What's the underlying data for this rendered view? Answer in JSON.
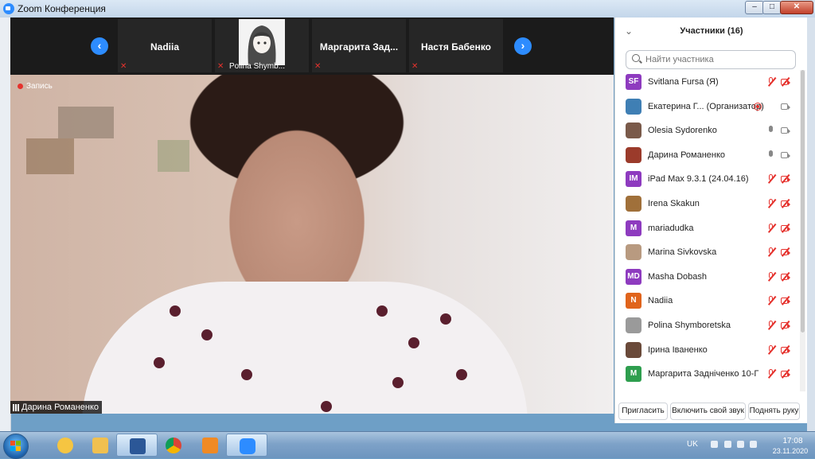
{
  "window": {
    "title": "Zoom Конференция",
    "btn_min": "–",
    "btn_max": "□",
    "btn_close": "✕"
  },
  "gallery": {
    "prev": "‹",
    "next": "›",
    "thumbs": [
      {
        "name": "Nadiia",
        "caption": ""
      },
      {
        "name": "",
        "caption": "Polina Shymb..."
      },
      {
        "name": "Маргарита  Зад...",
        "caption": ""
      },
      {
        "name": "Настя Бабенко",
        "caption": ""
      }
    ]
  },
  "video": {
    "recording": "Запись",
    "speaker": "Дарина Романенко"
  },
  "participants": {
    "title": "Участники (16)",
    "search_placeholder": "Найти участника",
    "list": [
      {
        "initials": "SF",
        "color": "#8e3bbf",
        "name": "Svitlana Fursa (Я)",
        "mic": "off",
        "cam": "off",
        "rec": false
      },
      {
        "initials": "",
        "color": "#3f7fb4",
        "name": "Екатерина Г... (Организатор)",
        "mic": "rec",
        "cam": "on",
        "rec": true
      },
      {
        "initials": "",
        "color": "#7a5a4a",
        "name": "Olesia Sydorenko",
        "mic": "on",
        "cam": "on",
        "rec": false
      },
      {
        "initials": "",
        "color": "#9b3b2b",
        "name": "Дарина Романенко",
        "mic": "on",
        "cam": "on",
        "rec": false
      },
      {
        "initials": "IM",
        "color": "#8e3bbf",
        "name": "iPad Max 9.3.1 (24.04.16)",
        "mic": "off",
        "cam": "off",
        "rec": false
      },
      {
        "initials": "",
        "color": "#a0703a",
        "name": "Irena Skakun",
        "mic": "off",
        "cam": "off",
        "rec": false
      },
      {
        "initials": "M",
        "color": "#8e3bbf",
        "name": "mariadudka",
        "mic": "off",
        "cam": "off",
        "rec": false
      },
      {
        "initials": "",
        "color": "#b89a80",
        "name": "Marina Sivkovska",
        "mic": "off",
        "cam": "off",
        "rec": false
      },
      {
        "initials": "MD",
        "color": "#8e3bbf",
        "name": "Masha Dobash",
        "mic": "off",
        "cam": "off",
        "rec": false
      },
      {
        "initials": "N",
        "color": "#e0641c",
        "name": "Nadiia",
        "mic": "off",
        "cam": "off",
        "rec": false
      },
      {
        "initials": "",
        "color": "#9a9a9a",
        "name": "Polina Shymboretska",
        "mic": "off",
        "cam": "off",
        "rec": false
      },
      {
        "initials": "",
        "color": "#6a4a3a",
        "name": "Ірина Іваненко",
        "mic": "off",
        "cam": "off",
        "rec": false
      },
      {
        "initials": "M",
        "color": "#2e9e4e",
        "name": "Маргарита Задніченко 10-Г",
        "mic": "off",
        "cam": "off",
        "rec": false
      }
    ],
    "btn_invite": "Пригласить",
    "btn_unmute": "Включить свой звук",
    "btn_raise": "Поднять руку"
  },
  "taskbar": {
    "apps": [
      "start-button",
      "app-eye",
      "file-explorer",
      "word",
      "chrome",
      "media-player",
      "zoom"
    ],
    "lang": "UK",
    "time": "17:08",
    "date": "23.11.2020"
  }
}
